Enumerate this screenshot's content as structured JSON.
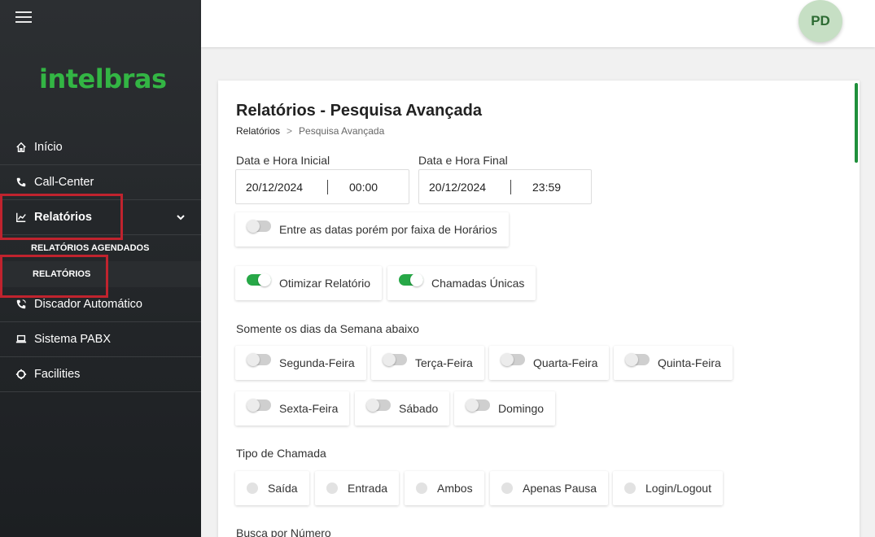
{
  "sidebar": {
    "logo": "intelbras",
    "items": [
      {
        "label": "Início",
        "icon": "home-icon"
      },
      {
        "label": "Call-Center",
        "icon": "phone-icon"
      },
      {
        "label": "Relatórios",
        "icon": "chart-line-icon"
      },
      {
        "label": "Discador Automático",
        "icon": "phone-dial-icon"
      },
      {
        "label": "Sistema PABX",
        "icon": "laptop-icon"
      },
      {
        "label": "Facilities",
        "icon": "target-icon"
      }
    ],
    "subitems": [
      {
        "label": "RELATÓRIOS AGENDADOS"
      },
      {
        "label": "RELATÓRIOS"
      }
    ]
  },
  "header": {
    "avatar_initials": "PD"
  },
  "page": {
    "title": "Relatórios - Pesquisa Avançada",
    "breadcrumb": {
      "parent": "Relatórios",
      "separator": ">",
      "current": "Pesquisa Avançada"
    }
  },
  "form": {
    "start": {
      "label": "Data e Hora Inicial",
      "date": "20/12/2024",
      "time": "00:00"
    },
    "end": {
      "label": "Data e Hora Final",
      "date": "20/12/2024",
      "time": "23:59"
    },
    "range_toggle": {
      "label": "Entre as datas porém por faixa de Horários",
      "on": false
    },
    "optimize_toggle": {
      "label": "Otimizar Relatório",
      "on": true
    },
    "unique_toggle": {
      "label": "Chamadas Únicas",
      "on": true
    },
    "weekdays_label": "Somente os dias da Semana abaixo",
    "weekdays": [
      {
        "label": "Segunda-Feira",
        "on": false
      },
      {
        "label": "Terça-Feira",
        "on": false
      },
      {
        "label": "Quarta-Feira",
        "on": false
      },
      {
        "label": "Quinta-Feira",
        "on": false
      },
      {
        "label": "Sexta-Feira",
        "on": false
      },
      {
        "label": "Sábado",
        "on": false
      },
      {
        "label": "Domingo",
        "on": false
      }
    ],
    "call_type_label": "Tipo de Chamada",
    "call_types": [
      {
        "label": "Saída"
      },
      {
        "label": "Entrada"
      },
      {
        "label": "Ambos"
      },
      {
        "label": "Apenas Pausa"
      },
      {
        "label": "Login/Logout"
      }
    ],
    "search_number_label": "Busca por Número"
  },
  "colors": {
    "accent": "#27a847",
    "highlight": "#c0232e",
    "logo": "#33b544"
  }
}
